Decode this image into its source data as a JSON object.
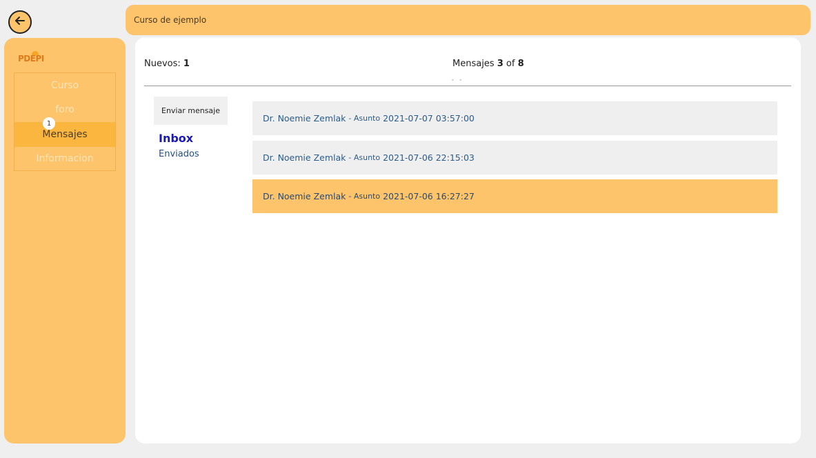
{
  "header": {
    "course_title": "Curso de ejemplo"
  },
  "icons": {
    "back": "arrow-left-circle-icon"
  },
  "colors": {
    "accent": "#fdc46b",
    "active_menu": "#fbb640",
    "link": "#2a5c8a",
    "inbox": "#1a1ab8"
  },
  "sidebar": {
    "logo": "PDEPI",
    "items": [
      {
        "label": "Curso"
      },
      {
        "label": "foro"
      },
      {
        "label": "Mensajes",
        "badge": "1"
      },
      {
        "label": "Informacion"
      }
    ]
  },
  "main": {
    "nuevos_label": "Nuevos:",
    "nuevos_count": "1",
    "pager": {
      "prefix": "Mensajes",
      "current": "3",
      "of": "of",
      "total": "8"
    },
    "send_button": "Enviar mensaje",
    "folders": {
      "inbox": "Inbox",
      "sent": "Enviados"
    },
    "messages": [
      {
        "sender": "Dr. Noemie Zemlak",
        "separator": " - ",
        "subject": "Asunto",
        "date": "2021-07-07 03:57:00"
      },
      {
        "sender": "Dr. Noemie Zemlak",
        "separator": " - ",
        "subject": "Asunto",
        "date": "2021-07-06 22:15:03"
      },
      {
        "sender": "Dr. Noemie Zemlak",
        "separator": " - ",
        "subject": "Asunto",
        "date": "2021-07-06 16:27:27"
      }
    ]
  }
}
